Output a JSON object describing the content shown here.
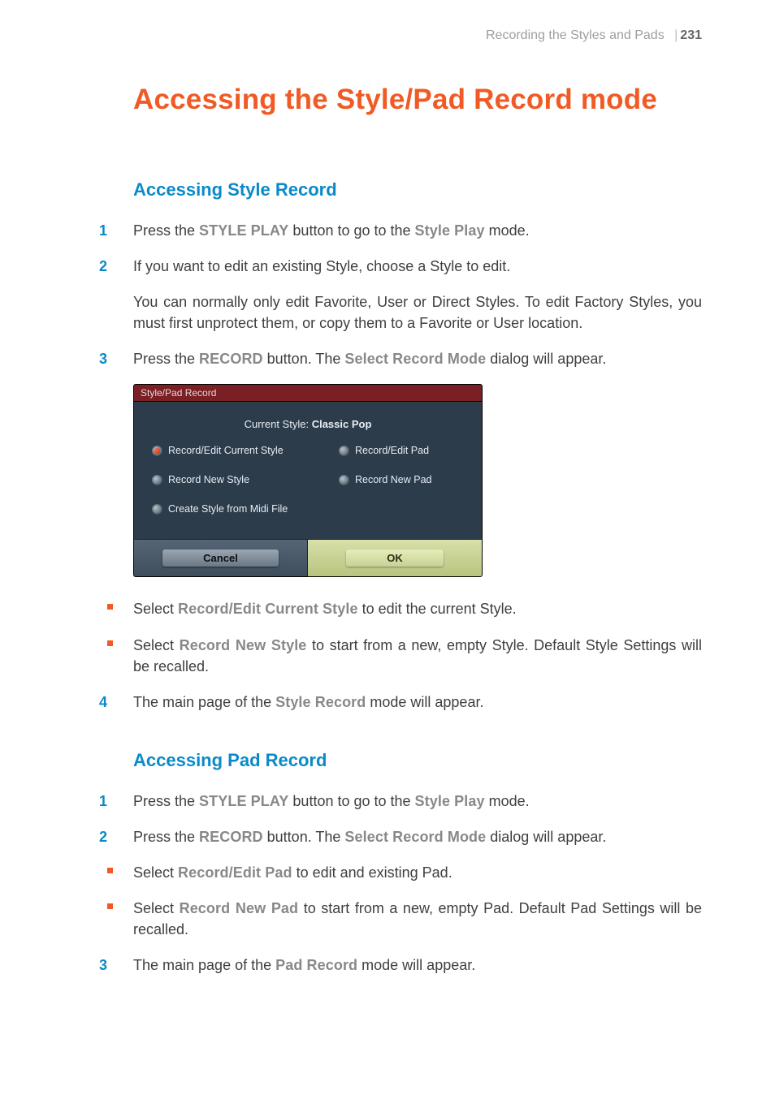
{
  "header": {
    "section": "Recording the Styles and Pads",
    "page": "231"
  },
  "title": "Accessing the Style/Pad Record mode",
  "section_a": {
    "heading": "Accessing Style Record",
    "s1": {
      "n": "1",
      "t1": "Press the ",
      "em1": "STYLE PLAY",
      "t2": " button to go to the ",
      "em2": "Style Play",
      "t3": " mode."
    },
    "s2": {
      "n": "2",
      "t": "If you want to edit an existing Style, choose a Style to edit."
    },
    "p1": "You can normally only edit Favorite, User or Direct Styles. To edit Factory Styles, you must first unprotect them, or copy them to a Favorite or User location.",
    "s3": {
      "n": "3",
      "t1": "Press the ",
      "em1": "RECORD",
      "t2": " button. The ",
      "em2": "Select Record Mode",
      "t3": " dialog will appear."
    },
    "b1": {
      "t1": "Select ",
      "em1": "Record/Edit Current Style",
      "t2": " to edit the current Style."
    },
    "b2": {
      "t1": "Select ",
      "em1": "Record New Style",
      "t2": " to start from a new, empty Style. Default Style Settings will be recalled."
    },
    "s4": {
      "n": "4",
      "t1": "The main page of the ",
      "em1": "Style Record",
      "t2": " mode will appear."
    }
  },
  "dialog": {
    "title": "Style/Pad Record",
    "sub_label": "Current Style: ",
    "sub_value": "Classic Pop",
    "opt1": "Record/Edit Current Style",
    "opt2": "Record/Edit Pad",
    "opt3": "Record New Style",
    "opt4": "Record New Pad",
    "opt5": "Create Style from Midi File",
    "cancel": "Cancel",
    "ok": "OK"
  },
  "section_b": {
    "heading": "Accessing Pad Record",
    "s1": {
      "n": "1",
      "t1": "Press the ",
      "em1": "STYLE PLAY",
      "t2": " button to go to the ",
      "em2": "Style Play",
      "t3": " mode."
    },
    "s2": {
      "n": "2",
      "t1": "Press the ",
      "em1": "RECORD",
      "t2": " button. The ",
      "em2": "Select Record Mode",
      "t3": " dialog will appear."
    },
    "b1": {
      "t1": "Select ",
      "em1": "Record/Edit Pad",
      "t2": " to edit and existing Pad."
    },
    "b2": {
      "t1": "Select ",
      "em1": "Record New Pad",
      "t2": " to start from a new, empty Pad. Default Pad Settings will be recalled."
    },
    "s3": {
      "n": "3",
      "t1": "The main page of the ",
      "em1": "Pad Record",
      "t2": " mode will appear."
    }
  }
}
